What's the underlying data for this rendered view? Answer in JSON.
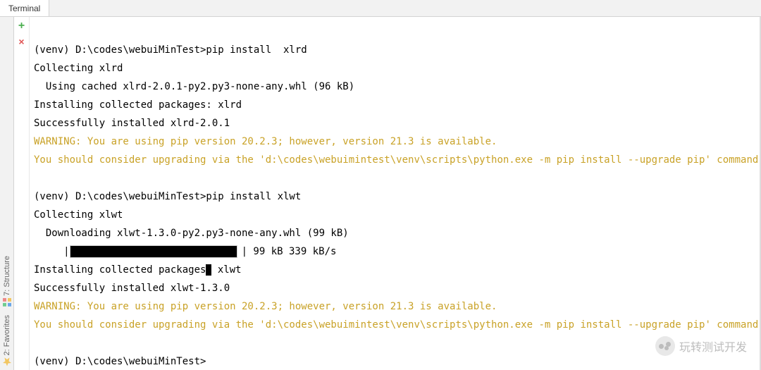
{
  "tab": {
    "title": "Terminal"
  },
  "sidebar": {
    "structure_label": "7: Structure",
    "favorites_label": "2: Favorites"
  },
  "toolbar": {
    "add_label": "+",
    "close_label": "×"
  },
  "terminal": {
    "lines": [
      {
        "type": "blank",
        "text": ""
      },
      {
        "type": "plain",
        "text": "(venv) D:\\codes\\webuiMinTest>pip install  xlrd"
      },
      {
        "type": "plain",
        "text": "Collecting xlrd"
      },
      {
        "type": "plain",
        "text": "  Using cached xlrd-2.0.1-py2.py3-none-any.whl (96 kB)"
      },
      {
        "type": "plain",
        "text": "Installing collected packages: xlrd"
      },
      {
        "type": "plain",
        "text": "Successfully installed xlrd-2.0.1"
      },
      {
        "type": "warn",
        "text": "WARNING: You are using pip version 20.2.3; however, version 21.3 is available."
      },
      {
        "type": "warn",
        "text": "You should consider upgrading via the 'd:\\codes\\webuimintest\\venv\\scripts\\python.exe -m pip install --upgrade pip' command."
      },
      {
        "type": "blank",
        "text": ""
      },
      {
        "type": "plain",
        "text": "(venv) D:\\codes\\webuiMinTest>pip install xlwt"
      },
      {
        "type": "plain",
        "text": "Collecting xlwt"
      },
      {
        "type": "plain",
        "text": "  Downloading xlwt-1.3.0-py2.py3-none-any.whl (99 kB)"
      },
      {
        "type": "progress",
        "indent": "     |",
        "label": "| 99 kB 339 kB/s"
      },
      {
        "type": "cursor-line",
        "before": "Installing collected packages",
        "after": " xlwt"
      },
      {
        "type": "plain",
        "text": "Successfully installed xlwt-1.3.0"
      },
      {
        "type": "warn",
        "text": "WARNING: You are using pip version 20.2.3; however, version 21.3 is available."
      },
      {
        "type": "warn",
        "text": "You should consider upgrading via the 'd:\\codes\\webuimintest\\venv\\scripts\\python.exe -m pip install --upgrade pip' command."
      },
      {
        "type": "blank",
        "text": ""
      },
      {
        "type": "plain",
        "text": "(venv) D:\\codes\\webuiMinTest>"
      }
    ]
  },
  "watermark": {
    "text": "玩转测试开发"
  }
}
